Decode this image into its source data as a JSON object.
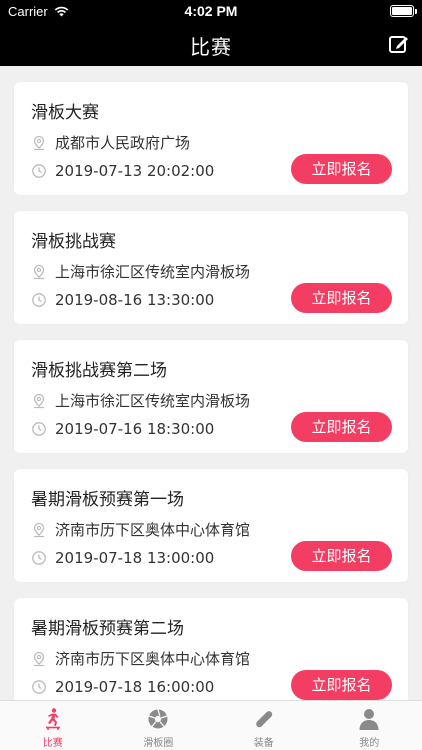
{
  "status_bar": {
    "carrier": "Carrier",
    "time": "4:02 PM"
  },
  "nav": {
    "title": "比赛",
    "edit_icon": "edit-icon"
  },
  "colors": {
    "accent": "#f43d63",
    "nav_bg": "#000000",
    "page_bg": "#f0f0f0"
  },
  "events": [
    {
      "name": "滑板大赛",
      "location": "成都市人民政府广场",
      "datetime": "2019-07-13 20:02:00",
      "button": "立即报名"
    },
    {
      "name": "滑板挑战赛",
      "location": "上海市徐汇区传统室内滑板场",
      "datetime": "2019-08-16 13:30:00",
      "button": "立即报名"
    },
    {
      "name": "滑板挑战赛第二场",
      "location": "上海市徐汇区传统室内滑板场",
      "datetime": "2019-07-16 18:30:00",
      "button": "立即报名"
    },
    {
      "name": "暑期滑板预赛第一场",
      "location": "济南市历下区奥体中心体育馆",
      "datetime": "2019-07-18 13:00:00",
      "button": "立即报名"
    },
    {
      "name": "暑期滑板预赛第二场",
      "location": "济南市历下区奥体中心体育馆",
      "datetime": "2019-07-18 16:00:00",
      "button": "立即报名"
    }
  ],
  "tabs": [
    {
      "label": "比赛",
      "icon": "skater-icon",
      "active": true
    },
    {
      "label": "滑板圈",
      "icon": "aperture-icon",
      "active": false
    },
    {
      "label": "装备",
      "icon": "skateboard-icon",
      "active": false
    },
    {
      "label": "我的",
      "icon": "user-icon",
      "active": false
    }
  ]
}
